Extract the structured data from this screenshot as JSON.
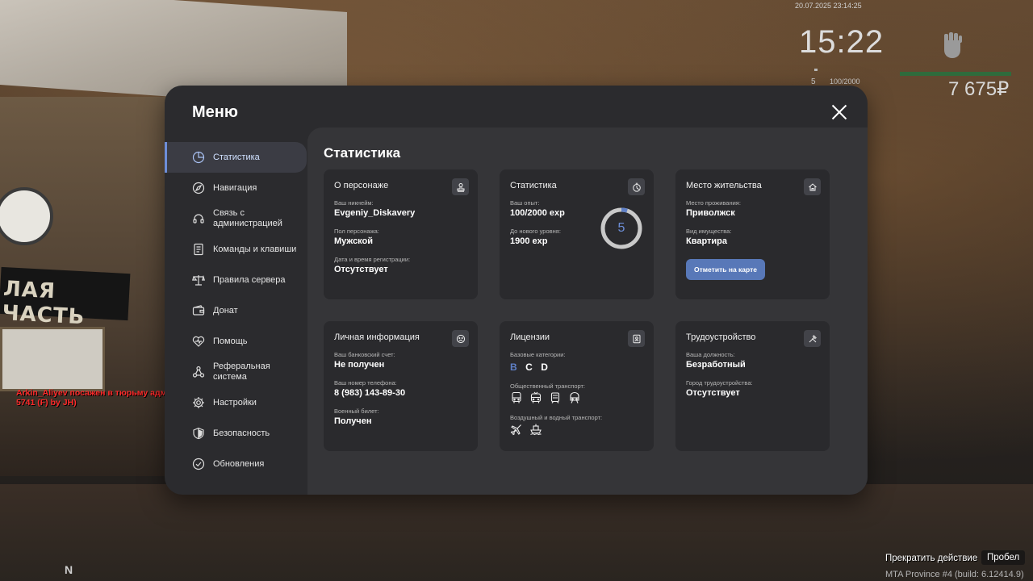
{
  "hud": {
    "datetime": "20.07.2025 23:14:25",
    "clock": "15:22",
    "level": "5",
    "exp": "100/2000",
    "money": "7 675₽"
  },
  "chat": {
    "message": "Arkin_Aliyev посажен в тюрьму администратором Jacob_Holmes (20 мин.) [Ф] ряд № 5741 (F) by JH)"
  },
  "footer": {
    "cancel_label": "Прекратить действие",
    "cancel_key": "Пробел",
    "build": "MTA Province #4 (build: 6.12414.9)",
    "n_label": "N"
  },
  "background": {
    "sign_text": "ЛАЯ ЧАСТЬ"
  },
  "menu": {
    "title": "Меню",
    "sidebar": [
      {
        "label": "Статистика",
        "icon": "pie-chart-icon",
        "active": true
      },
      {
        "label": "Навигация",
        "icon": "compass-icon"
      },
      {
        "label": "Связь с администрацией",
        "icon": "headset-icon"
      },
      {
        "label": "Команды и клавиши",
        "icon": "document-icon"
      },
      {
        "label": "Правила сервера",
        "icon": "scales-icon"
      },
      {
        "label": "Донат",
        "icon": "wallet-icon"
      },
      {
        "label": "Помощь",
        "icon": "heart-icon"
      },
      {
        "label": "Реферальная система",
        "icon": "network-icon"
      },
      {
        "label": "Настройки",
        "icon": "gear-icon"
      },
      {
        "label": "Безопасность",
        "icon": "shield-icon"
      },
      {
        "label": "Обновления",
        "icon": "check-circle-icon"
      }
    ],
    "content_title": "Статистика",
    "cards": {
      "character": {
        "title": "О персонаже",
        "nick_label": "Ваш никнейм:",
        "nick": "Evgeniy_Diskavery",
        "gender_label": "Пол персонажа:",
        "gender": "Мужской",
        "reg_label": "Дата и время регистрации:",
        "reg": "Отсутствует"
      },
      "stats": {
        "title": "Статистика",
        "exp_label": "Ваш опыт:",
        "exp": "100/2000 exp",
        "next_label": "До нового уровня:",
        "next": "1900 exp",
        "level": "5",
        "progress": 0.05
      },
      "residence": {
        "title": "Место жительства",
        "place_label": "Место проживания:",
        "place": "Приволжск",
        "type_label": "Вид имущества:",
        "type": "Квартира",
        "map_button": "Отметить на карте"
      },
      "personal": {
        "title": "Личная информация",
        "bank_label": "Ваш банковский счет:",
        "bank": "Не получен",
        "phone_label": "Ваш номер телефона:",
        "phone": "8 (983) 143-89-30",
        "military_label": "Военный билет:",
        "military": "Получен"
      },
      "licenses": {
        "title": "Лицензии",
        "base_label": "Базовые категории:",
        "categories": [
          {
            "label": "B",
            "active": true
          },
          {
            "label": "C"
          },
          {
            "label": "D"
          }
        ],
        "public_label": "Общественный транспорт:",
        "air_label": "Воздушный и водный транспорт:"
      },
      "employment": {
        "title": "Трудоустройство",
        "job_label": "Ваша должность:",
        "job": "Безработный",
        "city_label": "Город трудоустройства:",
        "city": "Отсутствует"
      }
    }
  }
}
